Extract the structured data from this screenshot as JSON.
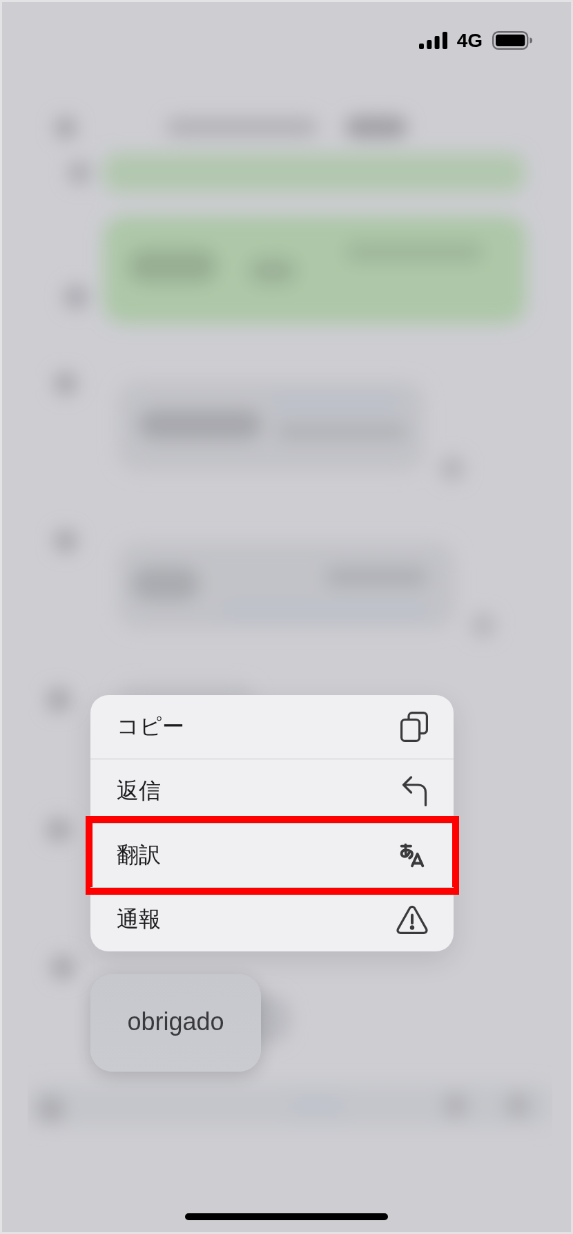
{
  "status_bar": {
    "network": "4G"
  },
  "context_menu": {
    "items": [
      {
        "label": "コピー",
        "kind": "copy",
        "highlighted": false
      },
      {
        "label": "返信",
        "kind": "reply",
        "highlighted": false
      },
      {
        "label": "翻訳",
        "kind": "translate",
        "highlighted": true
      },
      {
        "label": "通報",
        "kind": "report",
        "highlighted": false
      }
    ]
  },
  "message_bubble": {
    "text": "obrigado"
  }
}
